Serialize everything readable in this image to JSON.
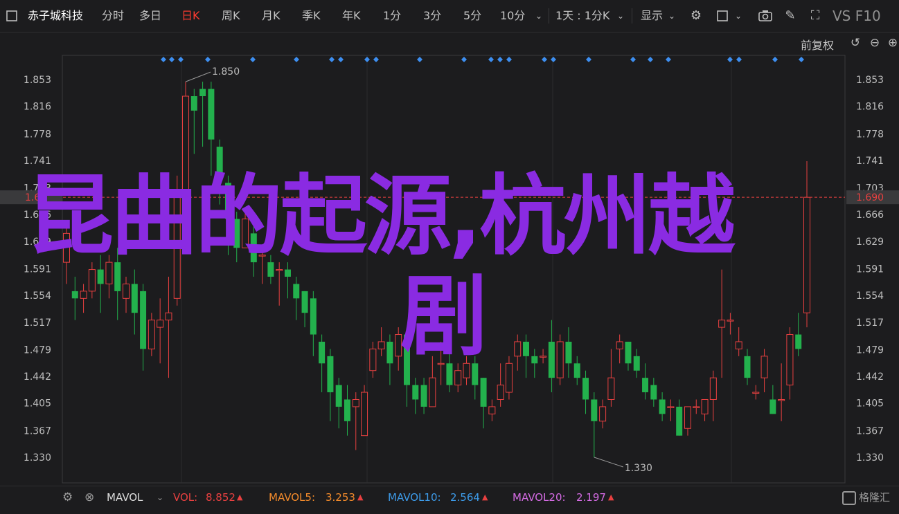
{
  "toolbar": {
    "stock_name": "赤子城科技",
    "periods": [
      "分时",
      "多日",
      "日K",
      "周K",
      "月K",
      "季K",
      "年K",
      "1分",
      "3分",
      "5分",
      "10分"
    ],
    "active_period": "日K",
    "range_select": "1天 : 1分K",
    "display_label": "显示",
    "vs_label": "VS F10"
  },
  "chart": {
    "adjust_label": "前复权",
    "current_price_label": "1.690",
    "left_current_label": "1.6"
  },
  "chart_data": {
    "type": "candlestick",
    "y_ticks": [
      "1.853",
      "1.816",
      "1.778",
      "1.741",
      "1.703",
      "1.666",
      "1.629",
      "1.591",
      "1.554",
      "1.517",
      "1.479",
      "1.442",
      "1.405",
      "1.367",
      "1.330"
    ],
    "ylim": [
      1.314,
      1.886
    ],
    "current_price": 1.69,
    "high_annotation": "1.850",
    "low_annotation": "1.330",
    "candles": [
      [
        1.6,
        1.64,
        1.57,
        1.65
      ],
      [
        1.56,
        1.55,
        1.52,
        1.58
      ],
      [
        1.55,
        1.56,
        1.53,
        1.57
      ],
      [
        1.56,
        1.59,
        1.55,
        1.6
      ],
      [
        1.59,
        1.57,
        1.53,
        1.61
      ],
      [
        1.57,
        1.6,
        1.55,
        1.61
      ],
      [
        1.6,
        1.56,
        1.52,
        1.62
      ],
      [
        1.55,
        1.57,
        1.53,
        1.58
      ],
      [
        1.57,
        1.53,
        1.5,
        1.59
      ],
      [
        1.56,
        1.48,
        1.45,
        1.57
      ],
      [
        1.48,
        1.52,
        1.47,
        1.53
      ],
      [
        1.51,
        1.52,
        1.46,
        1.55
      ],
      [
        1.52,
        1.53,
        1.44,
        1.58
      ],
      [
        1.55,
        1.7,
        1.54,
        1.72
      ],
      [
        1.69,
        1.83,
        1.67,
        1.85
      ],
      [
        1.83,
        1.81,
        1.75,
        1.84
      ],
      [
        1.84,
        1.83,
        1.76,
        1.85
      ],
      [
        1.84,
        1.77,
        1.72,
        1.85
      ],
      [
        1.76,
        1.72,
        1.68,
        1.77
      ],
      [
        1.71,
        1.66,
        1.61,
        1.72
      ],
      [
        1.66,
        1.62,
        1.6,
        1.67
      ],
      [
        1.62,
        1.66,
        1.62,
        1.67
      ],
      [
        1.64,
        1.6,
        1.58,
        1.65
      ],
      [
        1.61,
        1.61,
        1.57,
        1.62
      ],
      [
        1.6,
        1.58,
        1.57,
        1.61
      ],
      [
        1.59,
        1.59,
        1.54,
        1.6
      ],
      [
        1.59,
        1.58,
        1.55,
        1.6
      ],
      [
        1.57,
        1.55,
        1.52,
        1.58
      ],
      [
        1.56,
        1.53,
        1.51,
        1.56
      ],
      [
        1.55,
        1.5,
        1.47,
        1.56
      ],
      [
        1.49,
        1.46,
        1.42,
        1.5
      ],
      [
        1.47,
        1.42,
        1.38,
        1.48
      ],
      [
        1.43,
        1.4,
        1.37,
        1.44
      ],
      [
        1.41,
        1.38,
        1.36,
        1.43
      ],
      [
        1.4,
        1.41,
        1.34,
        1.42
      ],
      [
        1.36,
        1.42,
        1.36,
        1.43
      ],
      [
        1.45,
        1.48,
        1.44,
        1.49
      ],
      [
        1.48,
        1.49,
        1.47,
        1.51
      ],
      [
        1.49,
        1.46,
        1.43,
        1.5
      ],
      [
        1.47,
        1.5,
        1.45,
        1.51
      ],
      [
        1.5,
        1.43,
        1.4,
        1.51
      ],
      [
        1.43,
        1.41,
        1.39,
        1.44
      ],
      [
        1.43,
        1.4,
        1.39,
        1.44
      ],
      [
        1.4,
        1.44,
        1.4,
        1.47
      ],
      [
        1.46,
        1.46,
        1.43,
        1.49
      ],
      [
        1.46,
        1.43,
        1.42,
        1.48
      ],
      [
        1.43,
        1.45,
        1.42,
        1.46
      ],
      [
        1.44,
        1.46,
        1.43,
        1.47
      ],
      [
        1.46,
        1.43,
        1.41,
        1.47
      ],
      [
        1.44,
        1.4,
        1.37,
        1.44
      ],
      [
        1.39,
        1.4,
        1.38,
        1.41
      ],
      [
        1.41,
        1.43,
        1.4,
        1.46
      ],
      [
        1.42,
        1.46,
        1.41,
        1.47
      ],
      [
        1.47,
        1.49,
        1.45,
        1.5
      ],
      [
        1.49,
        1.47,
        1.44,
        1.5
      ],
      [
        1.47,
        1.46,
        1.44,
        1.48
      ],
      [
        1.47,
        1.47,
        1.46,
        1.48
      ],
      [
        1.49,
        1.44,
        1.42,
        1.52
      ],
      [
        1.44,
        1.49,
        1.43,
        1.5
      ],
      [
        1.49,
        1.46,
        1.44,
        1.51
      ],
      [
        1.46,
        1.44,
        1.43,
        1.47
      ],
      [
        1.44,
        1.41,
        1.39,
        1.45
      ],
      [
        1.41,
        1.38,
        1.33,
        1.42
      ],
      [
        1.38,
        1.4,
        1.37,
        1.41
      ],
      [
        1.41,
        1.44,
        1.4,
        1.48
      ],
      [
        1.48,
        1.49,
        1.46,
        1.5
      ],
      [
        1.49,
        1.46,
        1.45,
        1.49
      ],
      [
        1.47,
        1.45,
        1.44,
        1.48
      ],
      [
        1.44,
        1.42,
        1.41,
        1.46
      ],
      [
        1.43,
        1.41,
        1.4,
        1.44
      ],
      [
        1.41,
        1.39,
        1.38,
        1.42
      ],
      [
        1.4,
        1.4,
        1.38,
        1.41
      ],
      [
        1.4,
        1.36,
        1.36,
        1.41
      ],
      [
        1.37,
        1.4,
        1.36,
        1.4
      ],
      [
        1.4,
        1.4,
        1.39,
        1.41
      ],
      [
        1.39,
        1.41,
        1.38,
        1.41
      ],
      [
        1.41,
        1.44,
        1.38,
        1.45
      ],
      [
        1.51,
        1.52,
        1.44,
        1.59
      ],
      [
        1.52,
        1.52,
        1.5,
        1.53
      ],
      [
        1.48,
        1.49,
        1.47,
        1.51
      ],
      [
        1.47,
        1.44,
        1.43,
        1.48
      ],
      [
        1.42,
        1.42,
        1.41,
        1.43
      ],
      [
        1.44,
        1.47,
        1.42,
        1.48
      ],
      [
        1.41,
        1.39,
        1.39,
        1.43
      ],
      [
        1.41,
        1.41,
        1.38,
        1.46
      ],
      [
        1.43,
        1.5,
        1.41,
        1.51
      ],
      [
        1.5,
        1.48,
        1.47,
        1.53
      ],
      [
        1.53,
        1.69,
        1.51,
        1.74
      ]
    ]
  },
  "markers_count": 30,
  "indicators": {
    "mavol_label": "MAVOL",
    "vol_label": "VOL:",
    "vol_value": "8.852",
    "mavol5_label": "MAVOL5:",
    "mavol5_value": "3.253",
    "mavol10_label": "MAVOL10:",
    "mavol10_value": "2.564",
    "mavol20_label": "MAVOL20:",
    "mavol20_value": "2.197",
    "brand": "格隆汇"
  },
  "headline": {
    "line1": "昆曲的起源,杭州越",
    "line2": "剧"
  },
  "colors": {
    "up": "#e84040",
    "down": "#23b14d",
    "accent": "#ff3b30",
    "headline": "#8a2be2",
    "marker": "#3d8ef0"
  }
}
